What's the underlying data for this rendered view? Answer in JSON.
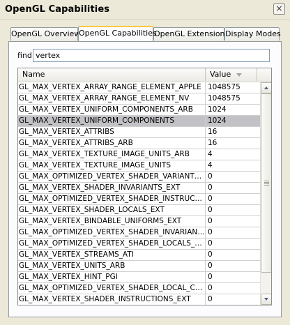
{
  "window": {
    "title": "OpenGL Capabilities",
    "close_glyph": "×"
  },
  "tabs": [
    {
      "label": "OpenGL Overview",
      "active": false
    },
    {
      "label": "OpenGL Capabilities",
      "active": true
    },
    {
      "label": "OpenGL Extensions",
      "active": false
    },
    {
      "label": "Display Modes",
      "active": false
    }
  ],
  "find": {
    "label": "find",
    "value": "vertex"
  },
  "table": {
    "columns": [
      "Name",
      "Value"
    ],
    "sort_icon": "sort-descending-icon",
    "selected_index": 3,
    "rows": [
      {
        "name": "GL_MAX_VERTEX_ARRAY_RANGE_ELEMENT_APPLE",
        "value": "1048575"
      },
      {
        "name": "GL_MAX_VERTEX_ARRAY_RANGE_ELEMENT_NV",
        "value": "1048575"
      },
      {
        "name": "GL_MAX_VERTEX_UNIFORM_COMPONENTS_ARB",
        "value": "1024"
      },
      {
        "name": "GL_MAX_VERTEX_UNIFORM_COMPONENTS",
        "value": "1024"
      },
      {
        "name": "GL_MAX_VERTEX_ATTRIBS",
        "value": "16"
      },
      {
        "name": "GL_MAX_VERTEX_ATTRIBS_ARB",
        "value": "16"
      },
      {
        "name": "GL_MAX_VERTEX_TEXTURE_IMAGE_UNITS_ARB",
        "value": "4"
      },
      {
        "name": "GL_MAX_VERTEX_TEXTURE_IMAGE_UNITS",
        "value": "4"
      },
      {
        "name": "GL_MAX_OPTIMIZED_VERTEX_SHADER_VARIANTS_...",
        "value": "0"
      },
      {
        "name": "GL_MAX_VERTEX_SHADER_INVARIANTS_EXT",
        "value": "0"
      },
      {
        "name": "GL_MAX_OPTIMIZED_VERTEX_SHADER_INSTRUCTI...",
        "value": "0"
      },
      {
        "name": "GL_MAX_VERTEX_SHADER_LOCALS_EXT",
        "value": "0"
      },
      {
        "name": "GL_MAX_VERTEX_BINDABLE_UNIFORMS_EXT",
        "value": "0"
      },
      {
        "name": "GL_MAX_OPTIMIZED_VERTEX_SHADER_INVARIANTS...",
        "value": "0"
      },
      {
        "name": "GL_MAX_OPTIMIZED_VERTEX_SHADER_LOCALS_EXT",
        "value": "0"
      },
      {
        "name": "GL_MAX_VERTEX_STREAMS_ATI",
        "value": "0"
      },
      {
        "name": "GL_MAX_VERTEX_UNITS_ARB",
        "value": "0"
      },
      {
        "name": "GL_MAX_VERTEX_HINT_PGI",
        "value": "0"
      },
      {
        "name": "GL_MAX_OPTIMIZED_VERTEX_SHADER_LOCAL_CON...",
        "value": "0"
      },
      {
        "name": "GL_MAX_VERTEX_SHADER_INSTRUCTIONS_EXT",
        "value": "0"
      }
    ]
  }
}
